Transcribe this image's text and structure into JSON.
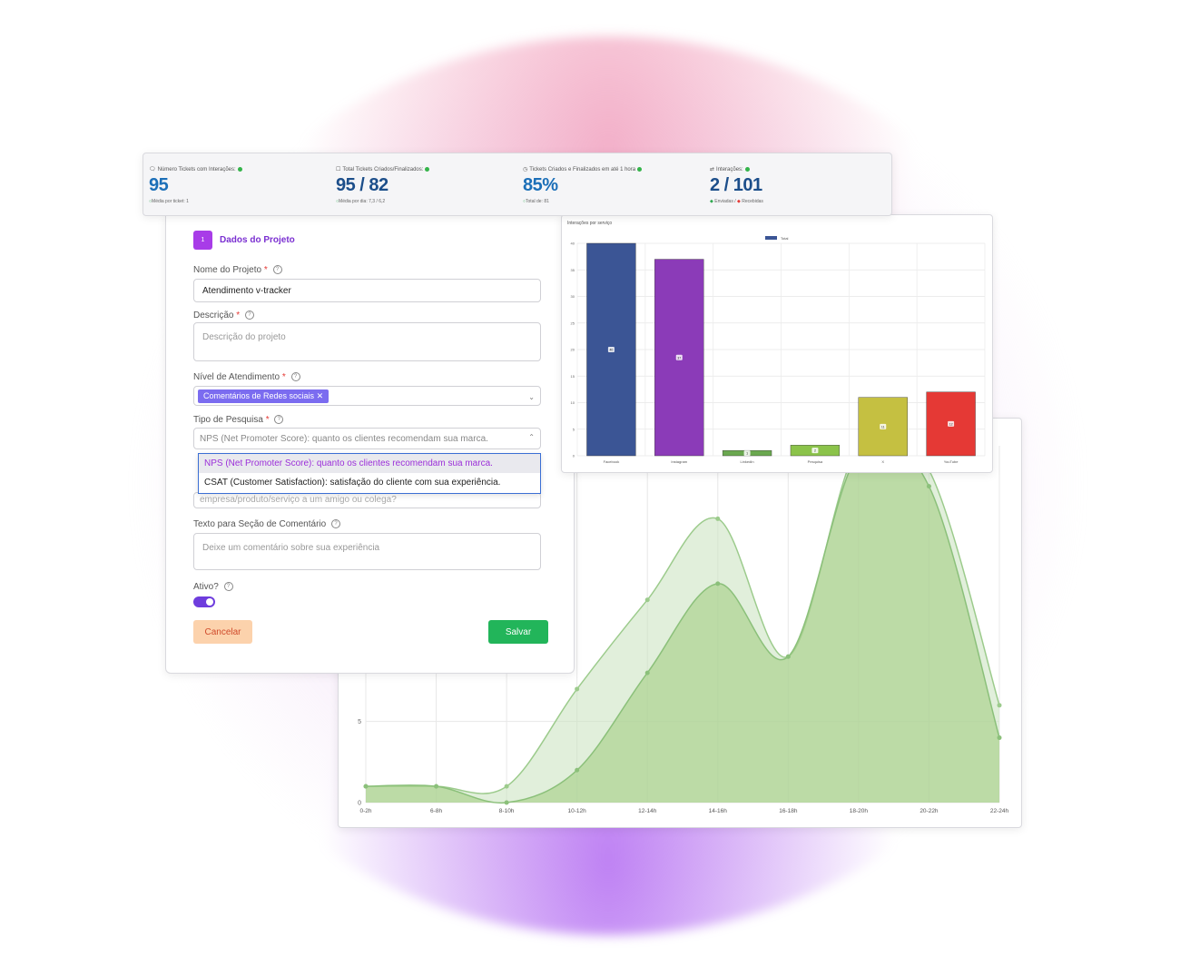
{
  "kpis": [
    {
      "title": "Número Tickets com Interações:",
      "value": "95",
      "sub": "Média por ticket: 1"
    },
    {
      "title": "Total Tickets Criados/Finalizados:",
      "value": "95 / 82",
      "sub": "Média por dia: 7,3 / 6,2"
    },
    {
      "title": "Tickets Criados e Finalizados em até 1 hora",
      "value": "85%",
      "sub": "Total de: 81"
    },
    {
      "title": "Interações:",
      "value": "2 / 101",
      "sub_sent": "Enviadas /",
      "sub_recv": "Recebidas"
    }
  ],
  "form": {
    "step_number": "1",
    "section_title": "Dados do Projeto",
    "name_label": "Nome do Projeto",
    "name_value": "Atendimento v-tracker",
    "desc_label": "Descrição",
    "desc_placeholder": "Descrição do projeto",
    "level_label": "Nível de Atendimento",
    "level_tag": "Comentários de Redes sociais",
    "survey_label": "Tipo de Pesquisa",
    "survey_value": "NPS (Net Promoter Score): quanto os clientes recomendam sua marca.",
    "survey_options": [
      "NPS (Net Promoter Score): quanto os clientes recomendam sua marca.",
      "CSAT (Customer Satisfaction): satisfação do cliente com sua experiência."
    ],
    "question_placeholder": "empresa/produto/serviço a um amigo ou colega?",
    "comment_label": "Texto para Seção de Comentário",
    "comment_placeholder": "Deixe um comentário sobre sua experiência",
    "active_label": "Ativo?",
    "cancel_label": "Cancelar",
    "save_label": "Salvar",
    "required_mark": "*",
    "help_mark": "?"
  },
  "colors": {
    "accent": "#a83ce8",
    "save": "#22b55a",
    "cancel_bg": "#fcd2ac",
    "kpi_value": "#1c6fb8",
    "area_fill": "#a8cf8a",
    "area_line": "#8bc07a"
  },
  "chart_data": [
    {
      "type": "bar",
      "title": "Interações por serviço",
      "legend": [
        "Total"
      ],
      "categories": [
        "Facebook",
        "Instagram",
        "LinkedIn",
        "Pesquisa",
        "X",
        "YouTube"
      ],
      "values": [
        40,
        37,
        1,
        2,
        11,
        12
      ],
      "colors": [
        "#3b5595",
        "#8b3bb8",
        "#6aa84f",
        "#8bc34a",
        "#c5c041",
        "#e53935"
      ],
      "yticks": [
        0,
        5,
        10,
        15,
        20,
        25,
        30,
        35,
        40
      ],
      "ylim": [
        0,
        40
      ]
    },
    {
      "type": "area",
      "categories": [
        "0-2h",
        "6-8h",
        "8-10h",
        "10-12h",
        "12-14h",
        "14-16h",
        "16-18h",
        "18-20h",
        "20-22h",
        "22-24h"
      ],
      "series": [
        {
          "values": [
            1,
            1,
            1,
            7,
            12.5,
            17.5,
            9,
            22,
            20.5,
            6
          ]
        },
        {
          "values": [
            1,
            1,
            0,
            2,
            8,
            13.5,
            9,
            21.5,
            19.5,
            4
          ]
        }
      ],
      "yticks": [
        0,
        5
      ],
      "ylim": [
        0,
        22
      ]
    }
  ]
}
